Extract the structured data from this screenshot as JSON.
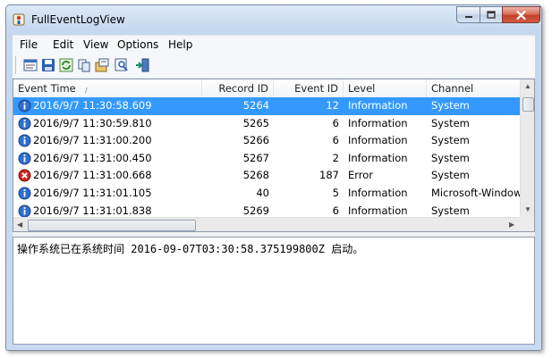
{
  "window": {
    "title": "FullEventLogView"
  },
  "menu": {
    "items": [
      "File",
      "Edit",
      "View",
      "Options",
      "Help"
    ]
  },
  "toolbar": {
    "buttons": [
      "properties-icon",
      "save-icon",
      "refresh-icon",
      "copy-icon",
      "options-icon",
      "find-icon",
      "exit-icon"
    ]
  },
  "table": {
    "columns": [
      "Event Time",
      "Record ID",
      "Event ID",
      "Level",
      "Channel"
    ],
    "rows": [
      {
        "icon": "info-icon",
        "time": "2016/9/7 11:30:58.609",
        "record_id": "5264",
        "event_id": "12",
        "level": "Information",
        "channel": "System",
        "selected": true
      },
      {
        "icon": "info-icon",
        "time": "2016/9/7 11:30:59.810",
        "record_id": "5265",
        "event_id": "6",
        "level": "Information",
        "channel": "System",
        "selected": false
      },
      {
        "icon": "info-icon",
        "time": "2016/9/7 11:31:00.200",
        "record_id": "5266",
        "event_id": "6",
        "level": "Information",
        "channel": "System",
        "selected": false
      },
      {
        "icon": "info-icon",
        "time": "2016/9/7 11:31:00.450",
        "record_id": "5267",
        "event_id": "2",
        "level": "Information",
        "channel": "System",
        "selected": false
      },
      {
        "icon": "error-icon",
        "time": "2016/9/7 11:31:00.668",
        "record_id": "5268",
        "event_id": "187",
        "level": "Error",
        "channel": "System",
        "selected": false
      },
      {
        "icon": "info-icon",
        "time": "2016/9/7 11:31:01.105",
        "record_id": "40",
        "event_id": "5",
        "level": "Information",
        "channel": "Microsoft-Windows-",
        "selected": false
      },
      {
        "icon": "info-icon",
        "time": "2016/9/7 11:31:01.838",
        "record_id": "5269",
        "event_id": "6",
        "level": "Information",
        "channel": "System",
        "selected": false
      }
    ]
  },
  "detail": {
    "text": "操作系统已在系统时间 2016-09-07T03:30:58.375199800Z 启动。"
  },
  "colors": {
    "selection": "#3399ff",
    "title_gradient": "#c6d8ee",
    "close_button": "#c4402a"
  }
}
